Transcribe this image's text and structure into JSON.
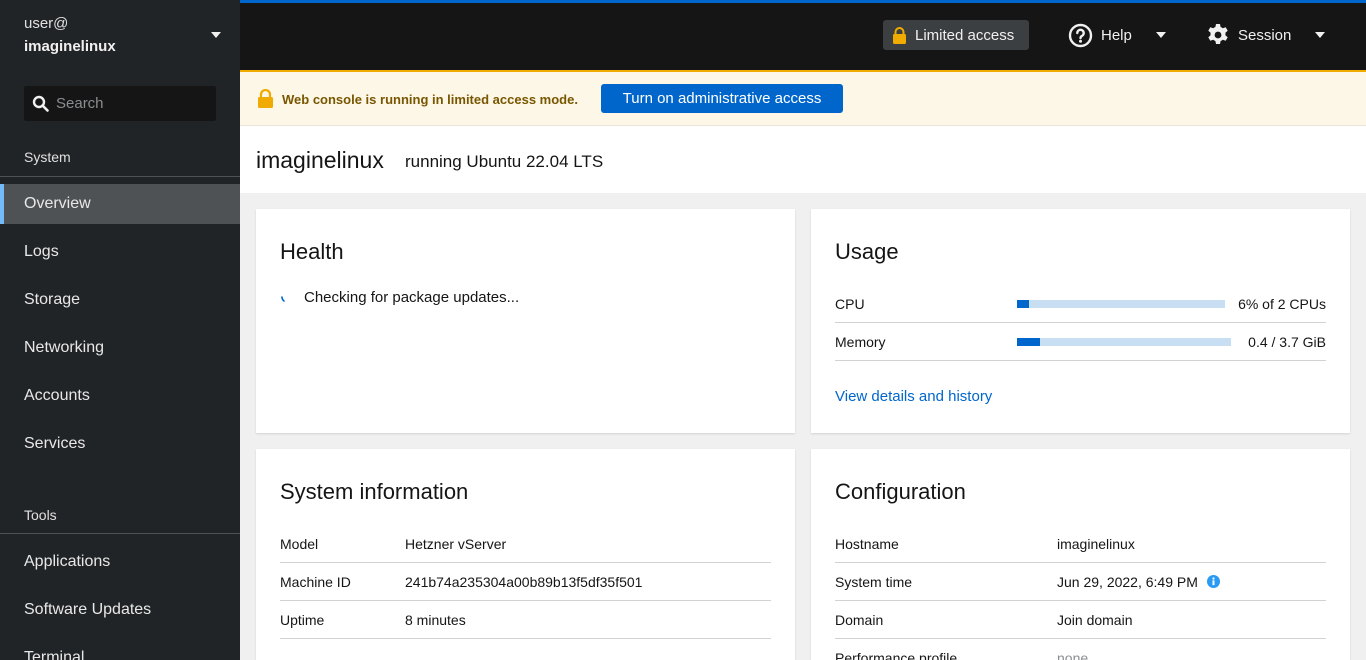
{
  "sidebar": {
    "host_user": "user@",
    "host_name": "imaginelinux",
    "search_placeholder": "Search",
    "sections": [
      {
        "title": "System",
        "items": [
          {
            "label": "Overview",
            "active": true
          },
          {
            "label": "Logs"
          },
          {
            "label": "Storage"
          },
          {
            "label": "Networking"
          },
          {
            "label": "Accounts"
          },
          {
            "label": "Services"
          }
        ]
      },
      {
        "title": "Tools",
        "items": [
          {
            "label": "Applications"
          },
          {
            "label": "Software Updates"
          },
          {
            "label": "Terminal"
          }
        ]
      }
    ]
  },
  "masthead": {
    "limited_access_label": "Limited access",
    "help_label": "Help",
    "session_label": "Session"
  },
  "alert": {
    "message": "Web console is running in limited access mode.",
    "action_label": "Turn on administrative access"
  },
  "page": {
    "title": "imaginelinux",
    "subtitle": "running Ubuntu 22.04 LTS"
  },
  "health": {
    "title": "Health",
    "status": "Checking for package updates..."
  },
  "usage": {
    "title": "Usage",
    "rows": [
      {
        "label": "CPU",
        "value": "6% of 2 CPUs",
        "fraction": 0.06
      },
      {
        "label": "Memory",
        "value": "0.4 / 3.7 GiB",
        "fraction": 0.108
      }
    ],
    "link_label": "View details and history"
  },
  "system_info": {
    "title": "System information",
    "rows": [
      {
        "key": "Model",
        "value": "Hetzner vServer"
      },
      {
        "key": "Machine ID",
        "value": "241b74a235304a00b89b13f5df35f501"
      },
      {
        "key": "Uptime",
        "value": "8 minutes"
      }
    ]
  },
  "configuration": {
    "title": "Configuration",
    "rows": [
      {
        "key": "Hostname",
        "value": "imaginelinux"
      },
      {
        "key": "System time",
        "value": "Jun 29, 2022, 6:49 PM"
      },
      {
        "key": "Domain",
        "value": "Join domain"
      },
      {
        "key": "Performance profile",
        "value": "none"
      }
    ]
  },
  "colors": {
    "accent": "#0066cc",
    "warning": "#f0ab00",
    "sidebar_bg": "#212427",
    "active_indicator": "#73bcf7"
  }
}
